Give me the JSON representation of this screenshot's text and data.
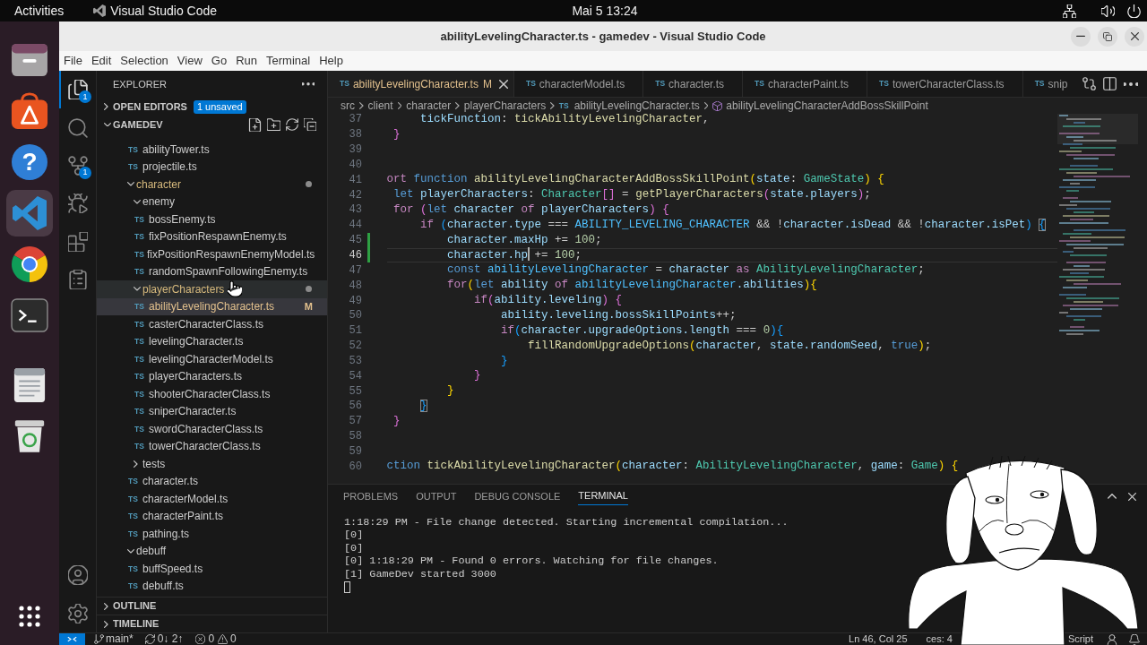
{
  "top_bar": {
    "activities": "Activities",
    "app_name": "Visual Studio Code",
    "clock": "Mai 5  13:24"
  },
  "dock": {
    "items": [
      {
        "kind": "files",
        "selected": false
      },
      {
        "kind": "app-center",
        "selected": false
      },
      {
        "kind": "help",
        "glyph": "?",
        "selected": false
      },
      {
        "kind": "code-editor",
        "selected": true
      },
      {
        "kind": "browser",
        "selected": false
      },
      {
        "kind": "terminal",
        "selected": false
      },
      {
        "kind": "text-editor",
        "selected": false
      },
      {
        "kind": "trash",
        "selected": false
      }
    ]
  },
  "window": {
    "title": "abilityLevelingCharacter.ts - gamedev - Visual Studio Code",
    "menu": [
      "File",
      "Edit",
      "Selection",
      "View",
      "Go",
      "Run",
      "Terminal",
      "Help"
    ]
  },
  "activity_bar": {
    "items": [
      {
        "kind": "explorer",
        "selected": true,
        "badge": "1"
      },
      {
        "kind": "search",
        "selected": false
      },
      {
        "kind": "source-control",
        "selected": false,
        "badge": "1"
      },
      {
        "kind": "run-debug",
        "selected": false
      },
      {
        "kind": "extensions",
        "selected": false
      },
      {
        "kind": "documents",
        "selected": false
      }
    ],
    "bottom": [
      {
        "kind": "account"
      },
      {
        "kind": "settings"
      }
    ]
  },
  "sidebar": {
    "title": "EXPLORER",
    "sections": [
      {
        "title": "OPEN EDITORS",
        "expanded": false,
        "badge": "1 unsaved"
      },
      {
        "title": "GAMEDEV",
        "expanded": true,
        "partial_folder_files": [
          {
            "kind": "file",
            "label": "abilityTower.ts",
            "icon": "TS",
            "selected": false,
            "hovered": false,
            "modified": false
          },
          {
            "kind": "file",
            "label": "projectile.ts",
            "icon": "TS",
            "selected": false,
            "hovered": false,
            "modified": false
          }
        ],
        "tree": [
          {
            "kind": "folder",
            "label": "character",
            "expanded": true,
            "selected": false,
            "hovered": false,
            "modified": true,
            "children": [
              {
                "kind": "folder",
                "label": "enemy",
                "expanded": true,
                "selected": false,
                "hovered": false,
                "modified": false,
                "children": [
                  {
                    "kind": "file",
                    "label": "bossEnemy.ts",
                    "icon": "TS",
                    "selected": false,
                    "hovered": false,
                    "modified": false
                  },
                  {
                    "kind": "file",
                    "label": "fixPositionRespawnEnemy.ts",
                    "icon": "TS",
                    "selected": false,
                    "hovered": false,
                    "modified": false
                  },
                  {
                    "kind": "file",
                    "label": "fixPositionRespawnEnemyModel.ts",
                    "icon": "TS",
                    "selected": false,
                    "hovered": false,
                    "modified": false
                  },
                  {
                    "kind": "file",
                    "label": "randomSpawnFollowingEnemy.ts",
                    "icon": "TS",
                    "selected": false,
                    "hovered": false,
                    "modified": false
                  }
                ]
              },
              {
                "kind": "folder",
                "label": "playerCharacters",
                "expanded": true,
                "selected": false,
                "hovered": true,
                "modified": true,
                "children": [
                  {
                    "kind": "file",
                    "label": "abilityLevelingCharacter.ts",
                    "icon": "TS",
                    "selected": true,
                    "hovered": false,
                    "modified": true,
                    "status": "M"
                  },
                  {
                    "kind": "file",
                    "label": "casterCharacterClass.ts",
                    "icon": "TS",
                    "selected": false,
                    "hovered": false,
                    "modified": false
                  },
                  {
                    "kind": "file",
                    "label": "levelingCharacter.ts",
                    "icon": "TS",
                    "selected": false,
                    "hovered": false,
                    "modified": false
                  },
                  {
                    "kind": "file",
                    "label": "levelingCharacterModel.ts",
                    "icon": "TS",
                    "selected": false,
                    "hovered": false,
                    "modified": false
                  },
                  {
                    "kind": "file",
                    "label": "playerCharacters.ts",
                    "icon": "TS",
                    "selected": false,
                    "hovered": false,
                    "modified": false
                  },
                  {
                    "kind": "file",
                    "label": "shooterCharacterClass.ts",
                    "icon": "TS",
                    "selected": false,
                    "hovered": false,
                    "modified": false
                  },
                  {
                    "kind": "file",
                    "label": "sniperCharacter.ts",
                    "icon": "TS",
                    "selected": false,
                    "hovered": false,
                    "modified": false
                  },
                  {
                    "kind": "file",
                    "label": "swordCharacterClass.ts",
                    "icon": "TS",
                    "selected": false,
                    "hovered": false,
                    "modified": false
                  },
                  {
                    "kind": "file",
                    "label": "towerCharacterClass.ts",
                    "icon": "TS",
                    "selected": false,
                    "hovered": false,
                    "modified": false
                  }
                ]
              },
              {
                "kind": "folder",
                "label": "tests",
                "expanded": false,
                "selected": false,
                "hovered": false,
                "modified": false
              },
              {
                "kind": "file",
                "label": "character.ts",
                "icon": "TS",
                "selected": false,
                "hovered": false,
                "modified": false
              },
              {
                "kind": "file",
                "label": "characterModel.ts",
                "icon": "TS",
                "selected": false,
                "hovered": false,
                "modified": false
              },
              {
                "kind": "file",
                "label": "characterPaint.ts",
                "icon": "TS",
                "selected": false,
                "hovered": false,
                "modified": false
              },
              {
                "kind": "file",
                "label": "pathing.ts",
                "icon": "TS",
                "selected": false,
                "hovered": false,
                "modified": false
              }
            ]
          },
          {
            "kind": "folder",
            "label": "debuff",
            "expanded": true,
            "selected": false,
            "hovered": false,
            "modified": false,
            "children": [
              {
                "kind": "file",
                "label": "buffSpeed.ts",
                "icon": "TS",
                "selected": false,
                "hovered": false,
                "modified": false
              },
              {
                "kind": "file",
                "label": "debuff.ts",
                "icon": "TS",
                "selected": false,
                "hovered": false,
                "modified": false
              }
            ]
          }
        ]
      },
      {
        "title": "OUTLINE",
        "expanded": false
      },
      {
        "title": "TIMELINE",
        "expanded": false
      }
    ]
  },
  "editor": {
    "tabs": [
      {
        "label": "abilityLevelingCharacter.ts",
        "icon": "TS",
        "selected": true,
        "modified": true,
        "status": "M"
      },
      {
        "label": "characterModel.ts",
        "icon": "TS",
        "selected": false,
        "modified": false
      },
      {
        "label": "character.ts",
        "icon": "TS",
        "selected": false,
        "modified": false
      },
      {
        "label": "characterPaint.ts",
        "icon": "TS",
        "selected": false,
        "modified": false
      },
      {
        "label": "towerCharacterClass.ts",
        "icon": "TS",
        "selected": false,
        "modified": false
      },
      {
        "label": "snip",
        "icon": "TS",
        "selected": false,
        "modified": false
      }
    ],
    "breadcrumb": [
      {
        "kind": "folder",
        "label": "src"
      },
      {
        "kind": "folder",
        "label": "client"
      },
      {
        "kind": "folder",
        "label": "character"
      },
      {
        "kind": "folder",
        "label": "playerCharacters"
      },
      {
        "kind": "file",
        "icon": "TS",
        "label": "abilityLevelingCharacter.ts"
      },
      {
        "kind": "symbol",
        "label": "abilityLevelingCharacterAddBossSkillPoint"
      }
    ],
    "lines": [
      {
        "number": "37",
        "active": false,
        "modified": false,
        "tokens": [
          {
            "kind": "var",
            "text": "     tickFunction"
          },
          {
            "kind": "pl",
            "text": ": "
          },
          {
            "kind": "fn",
            "text": "tickAbilityLevelingCharacter"
          },
          {
            "kind": "pl",
            "text": ","
          }
        ]
      },
      {
        "number": "38",
        "active": false,
        "modified": false,
        "tokens": [
          {
            "kind": "b2",
            "text": " }"
          }
        ]
      },
      {
        "number": "39",
        "active": false,
        "modified": false
      },
      {
        "number": "40",
        "active": false,
        "modified": false
      },
      {
        "number": "41",
        "active": false,
        "modified": false,
        "tokens": [
          {
            "kind": "ctl",
            "text": "ort"
          },
          {
            "kind": "kw",
            "text": " function"
          },
          {
            "kind": "fn",
            "text": " abilityLevelingCharacterAddBossSkillPoint"
          },
          {
            "kind": "b1",
            "text": "("
          },
          {
            "kind": "var",
            "text": "state"
          },
          {
            "kind": "pl",
            "text": ": "
          },
          {
            "kind": "ty",
            "text": "GameState"
          },
          {
            "kind": "b1",
            "text": ")"
          },
          {
            "kind": "b1",
            "text": " {"
          }
        ]
      },
      {
        "number": "42",
        "active": false,
        "modified": false,
        "tokens": [
          {
            "kind": "kw",
            "text": " let"
          },
          {
            "kind": "var",
            "text": " playerCharacters"
          },
          {
            "kind": "pl",
            "text": ": "
          },
          {
            "kind": "ty",
            "text": "Character"
          },
          {
            "kind": "b2",
            "text": "[]"
          },
          {
            "kind": "pl",
            "text": " = "
          },
          {
            "kind": "fn",
            "text": "getPlayerCharacters"
          },
          {
            "kind": "b2",
            "text": "("
          },
          {
            "kind": "var",
            "text": "state.players"
          },
          {
            "kind": "b2",
            "text": ")"
          },
          {
            "kind": "pl",
            "text": ";"
          }
        ]
      },
      {
        "number": "43",
        "active": false,
        "modified": false,
        "tokens": [
          {
            "kind": "ctl",
            "text": " for"
          },
          {
            "kind": "b2",
            "text": " ("
          },
          {
            "kind": "kw",
            "text": "let"
          },
          {
            "kind": "var",
            "text": " character"
          },
          {
            "kind": "ctl",
            "text": " of"
          },
          {
            "kind": "var",
            "text": " playerCharacters"
          },
          {
            "kind": "b2",
            "text": ")"
          },
          {
            "kind": "b2",
            "text": " {"
          }
        ]
      },
      {
        "number": "44",
        "active": false,
        "modified": false,
        "tokens": [
          {
            "kind": "ctl",
            "text": "     if"
          },
          {
            "kind": "b3",
            "text": " ("
          },
          {
            "kind": "var",
            "text": "character.type"
          },
          {
            "kind": "pl",
            "text": " === "
          },
          {
            "kind": "cst",
            "text": "ABILITY_LEVELING_CHARACTER"
          },
          {
            "kind": "pl",
            "text": " && !"
          },
          {
            "kind": "var",
            "text": "character.isDead"
          },
          {
            "kind": "pl",
            "text": " && !"
          },
          {
            "kind": "var",
            "text": "character.isPet"
          },
          {
            "kind": "b3",
            "text": ") "
          },
          {
            "kind": "match",
            "text": "{"
          }
        ]
      },
      {
        "number": "45",
        "active": false,
        "modified": true,
        "tokens": [
          {
            "kind": "var",
            "text": "         character.maxHp"
          },
          {
            "kind": "pl",
            "text": " += "
          },
          {
            "kind": "num",
            "text": "100"
          },
          {
            "kind": "pl",
            "text": ";"
          }
        ]
      },
      {
        "number": "46",
        "active": true,
        "modified": true,
        "tokens": [
          {
            "kind": "var",
            "text": "         character.hp"
          },
          {
            "kind": "cursor"
          },
          {
            "kind": "pl",
            "text": " += "
          },
          {
            "kind": "num",
            "text": "100"
          },
          {
            "kind": "pl",
            "text": ";"
          }
        ]
      },
      {
        "number": "47",
        "active": false,
        "modified": false,
        "tokens": [
          {
            "kind": "kw",
            "text": "         const"
          },
          {
            "kind": "cst",
            "text": " abilityLevelingCharacter"
          },
          {
            "kind": "pl",
            "text": " = "
          },
          {
            "kind": "var",
            "text": "character"
          },
          {
            "kind": "ctl",
            "text": " as"
          },
          {
            "kind": "ty",
            "text": " AbilityLevelingCharacter"
          },
          {
            "kind": "pl",
            "text": ";"
          }
        ]
      },
      {
        "number": "48",
        "active": false,
        "modified": false,
        "tokens": [
          {
            "kind": "ctl",
            "text": "         for"
          },
          {
            "kind": "b1",
            "text": "("
          },
          {
            "kind": "kw",
            "text": "let"
          },
          {
            "kind": "var",
            "text": " ability"
          },
          {
            "kind": "ctl",
            "text": " of"
          },
          {
            "kind": "cst",
            "text": " abilityLevelingCharacter"
          },
          {
            "kind": "var",
            "text": ".abilities"
          },
          {
            "kind": "b1",
            "text": ")"
          },
          {
            "kind": "b1",
            "text": "{"
          }
        ]
      },
      {
        "number": "49",
        "active": false,
        "modified": false,
        "tokens": [
          {
            "kind": "ctl",
            "text": "             if"
          },
          {
            "kind": "b2",
            "text": "("
          },
          {
            "kind": "var",
            "text": "ability.leveling"
          },
          {
            "kind": "b2",
            "text": ")"
          },
          {
            "kind": "b2",
            "text": " {"
          }
        ]
      },
      {
        "number": "50",
        "active": false,
        "modified": false,
        "tokens": [
          {
            "kind": "var",
            "text": "                 ability.leveling.bossSkillPoints"
          },
          {
            "kind": "pl",
            "text": "++;"
          }
        ]
      },
      {
        "number": "51",
        "active": false,
        "modified": false,
        "tokens": [
          {
            "kind": "ctl",
            "text": "                 if"
          },
          {
            "kind": "b3",
            "text": "("
          },
          {
            "kind": "var",
            "text": "character.upgradeOptions.length"
          },
          {
            "kind": "pl",
            "text": " === "
          },
          {
            "kind": "num",
            "text": "0"
          },
          {
            "kind": "b3",
            "text": ")"
          },
          {
            "kind": "b3",
            "text": "{"
          }
        ]
      },
      {
        "number": "52",
        "active": false,
        "modified": false,
        "tokens": [
          {
            "kind": "fn",
            "text": "                     fillRandomUpgradeOptions"
          },
          {
            "kind": "b1",
            "text": "("
          },
          {
            "kind": "var",
            "text": "character"
          },
          {
            "kind": "pl",
            "text": ", "
          },
          {
            "kind": "var",
            "text": "state.randomSeed"
          },
          {
            "kind": "pl",
            "text": ", "
          },
          {
            "kind": "kw",
            "text": "true"
          },
          {
            "kind": "b1",
            "text": ")"
          },
          {
            "kind": "pl",
            "text": ";"
          }
        ]
      },
      {
        "number": "53",
        "active": false,
        "modified": false,
        "tokens": [
          {
            "kind": "b3",
            "text": "                 }"
          }
        ]
      },
      {
        "number": "54",
        "active": false,
        "modified": false,
        "tokens": [
          {
            "kind": "b2",
            "text": "             }"
          }
        ]
      },
      {
        "number": "55",
        "active": false,
        "modified": false,
        "tokens": [
          {
            "kind": "b1",
            "text": "         }"
          }
        ]
      },
      {
        "number": "56",
        "active": false,
        "modified": false,
        "tokens": [
          {
            "kind": "match",
            "text": "     }"
          }
        ]
      },
      {
        "number": "57",
        "active": false,
        "modified": false,
        "tokens": [
          {
            "kind": "b2",
            "text": " }"
          }
        ]
      },
      {
        "number": "58",
        "active": false,
        "modified": false
      },
      {
        "number": "59",
        "active": false,
        "modified": false
      },
      {
        "number": "60",
        "active": false,
        "modified": false,
        "tokens": [
          {
            "kind": "kw",
            "text": "ction"
          },
          {
            "kind": "fn",
            "text": " tickAbilityLevelingCharacter"
          },
          {
            "kind": "b1",
            "text": "("
          },
          {
            "kind": "var",
            "text": "character"
          },
          {
            "kind": "pl",
            "text": ": "
          },
          {
            "kind": "ty",
            "text": "AbilityLevelingCharacter"
          },
          {
            "kind": "pl",
            "text": ", "
          },
          {
            "kind": "var",
            "text": "game"
          },
          {
            "kind": "pl",
            "text": ": "
          },
          {
            "kind": "ty",
            "text": "Game"
          },
          {
            "kind": "b1",
            "text": ")"
          },
          {
            "kind": "b1",
            "text": " {"
          }
        ]
      }
    ]
  },
  "panel": {
    "tabs": [
      {
        "label": "PROBLEMS",
        "selected": false
      },
      {
        "label": "OUTPUT",
        "selected": false
      },
      {
        "label": "DEBUG CONSOLE",
        "selected": false
      },
      {
        "label": "TERMINAL",
        "selected": true
      }
    ],
    "terminal_lines": [
      "1:18:29 PM - File change detected. Starting incremental compilation...",
      "[0]",
      "[0]",
      "[0] 1:18:29 PM - Found 0 errors. Watching for file changes.",
      "[1] GameDev started 3000"
    ]
  },
  "status_bar": {
    "branch": "main*",
    "sync": "0↓ 2↑",
    "errors": "0",
    "warnings": "0",
    "position": "Ln 46, Col 25",
    "indentation": "ces: 4",
    "language": "Script"
  }
}
